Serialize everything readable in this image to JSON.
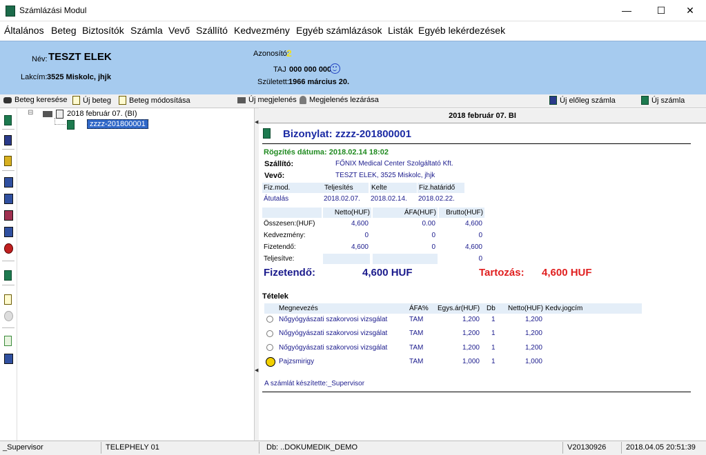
{
  "window": {
    "title": "Számlázási Modul",
    "min": "—",
    "max": "☐",
    "close": "✕"
  },
  "menu": [
    "Általános",
    "Beteg",
    "Biztosítók",
    "Számla",
    "Vevő",
    "Szállító",
    "Kedvezmény",
    "Egyéb számlázások",
    "Listák",
    "Egyéb lekérdezések"
  ],
  "patient": {
    "name_label": "Név:",
    "name": "TESZT ELEK",
    "address_label": "Lakcím:",
    "address": "3525 Miskolc, jhjk",
    "id_label": "Azonosító:",
    "id": "2",
    "taj_label": "TAJ",
    "taj": "000 000 000",
    "birth_label": "Született:",
    "birth": "1966 március 20."
  },
  "toolbar": {
    "search": "Beteg keresése",
    "new_patient": "Új beteg",
    "edit_patient": "Beteg módosítása",
    "new_visit": "Új megjelenés",
    "close_visit": "Megjelenés lezárása",
    "new_advance": "Új előleg számla",
    "new_invoice": "Új számla"
  },
  "tree": {
    "node": "2018 február 07. (BI)",
    "child": "zzzz-201800001",
    "expander": "⊟"
  },
  "panel": {
    "header": "2018 február 07.   BI",
    "title": "Bizonylat: zzzz-201800001",
    "recorded": "Rögzítés dátuma: 2018.02.14 18:02",
    "supplier_label": "Szállító:",
    "supplier": "FŐNIX Medical Center Szolgáltató Kft.",
    "buyer_label": "Vevő:",
    "buyer": "TESZT ELEK, 3525 Miskolc, jhjk",
    "pay": {
      "h_mode": "Fiz.mod.",
      "h_perf": "Teljesítés",
      "h_issue": "Kelte",
      "h_due": "Fiz.határidő",
      "mode": "Átutalás",
      "perf": "2018.02.07.",
      "issue": "2018.02.14.",
      "due": "2018.02.22."
    },
    "totals": {
      "h_net": "Netto(HUF)",
      "h_vat": "ÁFA(HUF)",
      "h_gross": "Brutto(HUF)",
      "rows": [
        {
          "label": "Összesen:(HUF)",
          "net": "4,600",
          "vat": "0.00",
          "gross": "4,600"
        },
        {
          "label": "Kedvezmény:",
          "net": "0",
          "vat": "0",
          "gross": "0"
        },
        {
          "label": "Fizetendő:",
          "net": "4,600",
          "vat": "0",
          "gross": "4,600"
        },
        {
          "label": "Teljesítve:",
          "net": "",
          "vat": "",
          "gross": "0"
        }
      ]
    },
    "payable_label": "Fizetendő:",
    "payable": "4,600 HUF",
    "debt_label": "Tartozás:",
    "debt": "4,600 HUF",
    "items_title": "Tételek",
    "items_header": {
      "name": "Megnevezés",
      "vat": "ÁFA%",
      "unit": "Egys.ár(HUF)",
      "qty": "Db",
      "net": "Netto(HUF)",
      "disc": "Kedv.jogcím"
    },
    "items": [
      {
        "name": "Nőgyógyászati szakorvosi vizsgálat",
        "vat": "TAM",
        "unit": "1,200",
        "qty": "1",
        "net": "1,200",
        "icon": "stethoscope-icon"
      },
      {
        "name": "Nőgyógyászati szakorvosi vizsgálat",
        "vat": "TAM",
        "unit": "1,200",
        "qty": "1",
        "net": "1,200",
        "icon": "stethoscope-icon"
      },
      {
        "name": "Nőgyógyászati szakorvosi vizsgálat",
        "vat": "TAM",
        "unit": "1,200",
        "qty": "1",
        "net": "1,200",
        "icon": "stethoscope-icon"
      },
      {
        "name": "Pajzsmirigy",
        "vat": "TAM",
        "unit": "1,000",
        "qty": "1",
        "net": "1,000",
        "icon": "radiation-icon"
      }
    ],
    "made_by": "A számlát készítette:_Supervisor"
  },
  "status": {
    "user": "_Supervisor",
    "site": "TELEPHELY 01",
    "db": "Db: ..DOKUMEDIK_DEMO",
    "version": "V20130926",
    "datetime": "2018.04.05 20:51:39"
  }
}
